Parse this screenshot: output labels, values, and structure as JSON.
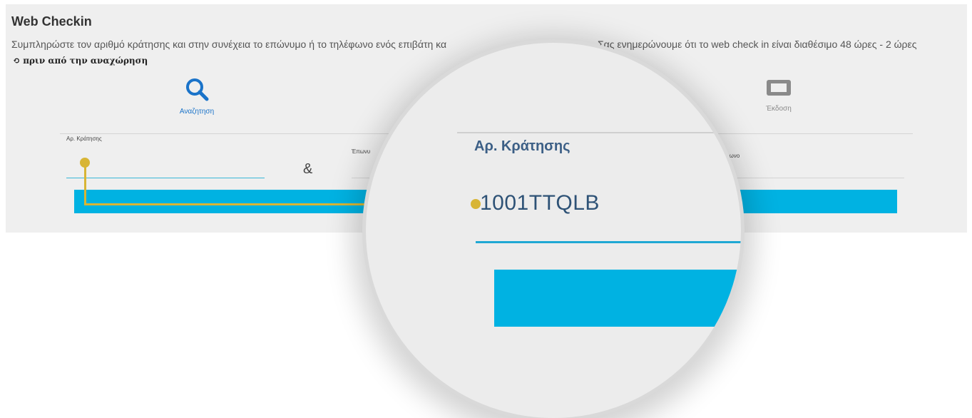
{
  "page": {
    "title": "Web Checkin",
    "description_left": "Συμπληρώστε τον αριθμό κράτησης και στην συνέχεια το επώνυμο ή το τηλέφωνο ενός επιβάτη κα",
    "description_right": "Σας ενημερώνουμε ότι το web check in είναι διαθέσιμο 48 ώρες - 2 ώρες",
    "description_line2": "πριν από την αναχώρηση"
  },
  "steps": [
    {
      "label": "Αναζητηση",
      "icon": "search-icon",
      "color": "#1a73c9"
    },
    {
      "label": "Έκδοση",
      "icon": "ticket-icon",
      "color": "#8a8a8a"
    }
  ],
  "form": {
    "booking_label": "Αρ. Κράτησης",
    "surname_label": "Έπωνυ",
    "phone_label": "ρωνο",
    "amp": "&"
  },
  "magnifier": {
    "label": "Αρ. Κράτησης",
    "value": "1001TTQLB"
  },
  "colors": {
    "accent": "#00b2e2",
    "highlight": "#d8b535",
    "label_blue": "#3c5f86"
  }
}
